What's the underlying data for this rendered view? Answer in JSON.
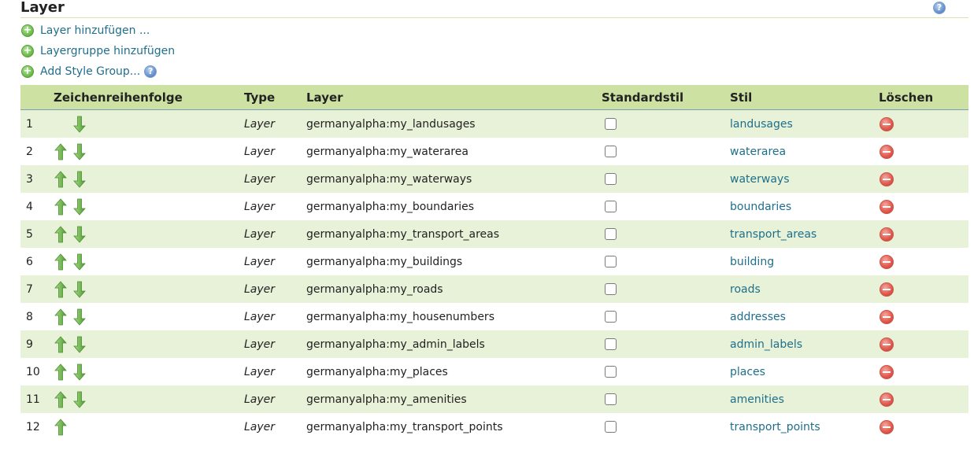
{
  "page": {
    "title": "Layer",
    "help_icon": "help-icon"
  },
  "actions": {
    "add_layer": "Layer hinzufügen ...",
    "add_layer_group": "Layergruppe hinzufügen",
    "add_style_group": "Add Style Group...",
    "icon": "plus-circle-icon"
  },
  "table": {
    "headers": {
      "order": "Zeichenreihenfolge",
      "type": "Type",
      "layer": "Layer",
      "default_style": "Standardstil",
      "style": "Stil",
      "delete": "Löschen"
    },
    "rows": [
      {
        "num": "1",
        "up": false,
        "down": true,
        "type": "Layer",
        "layer": "germanyalpha:my_landusages",
        "default_style": false,
        "style": "landusages"
      },
      {
        "num": "2",
        "up": true,
        "down": true,
        "type": "Layer",
        "layer": "germanyalpha:my_waterarea",
        "default_style": false,
        "style": "waterarea"
      },
      {
        "num": "3",
        "up": true,
        "down": true,
        "type": "Layer",
        "layer": "germanyalpha:my_waterways",
        "default_style": false,
        "style": "waterways"
      },
      {
        "num": "4",
        "up": true,
        "down": true,
        "type": "Layer",
        "layer": "germanyalpha:my_boundaries",
        "default_style": false,
        "style": "boundaries"
      },
      {
        "num": "5",
        "up": true,
        "down": true,
        "type": "Layer",
        "layer": "germanyalpha:my_transport_areas",
        "default_style": false,
        "style": "transport_areas"
      },
      {
        "num": "6",
        "up": true,
        "down": true,
        "type": "Layer",
        "layer": "germanyalpha:my_buildings",
        "default_style": false,
        "style": "building"
      },
      {
        "num": "7",
        "up": true,
        "down": true,
        "type": "Layer",
        "layer": "germanyalpha:my_roads",
        "default_style": false,
        "style": "roads"
      },
      {
        "num": "8",
        "up": true,
        "down": true,
        "type": "Layer",
        "layer": "germanyalpha:my_housenumbers",
        "default_style": false,
        "style": "addresses"
      },
      {
        "num": "9",
        "up": true,
        "down": true,
        "type": "Layer",
        "layer": "germanyalpha:my_admin_labels",
        "default_style": false,
        "style": "admin_labels"
      },
      {
        "num": "10",
        "up": true,
        "down": true,
        "type": "Layer",
        "layer": "germanyalpha:my_places",
        "default_style": false,
        "style": "places"
      },
      {
        "num": "11",
        "up": true,
        "down": true,
        "type": "Layer",
        "layer": "germanyalpha:my_amenities",
        "default_style": false,
        "style": "amenities"
      },
      {
        "num": "12",
        "up": true,
        "down": false,
        "type": "Layer",
        "layer": "germanyalpha:my_transport_points",
        "default_style": false,
        "style": "transport_points"
      }
    ]
  },
  "colors": {
    "header_bg": "#cde1a2",
    "row_alt": "#e8f2d8",
    "link": "#1f6f8b",
    "arrow": "#6cb04a",
    "delete": "#e0574b"
  }
}
